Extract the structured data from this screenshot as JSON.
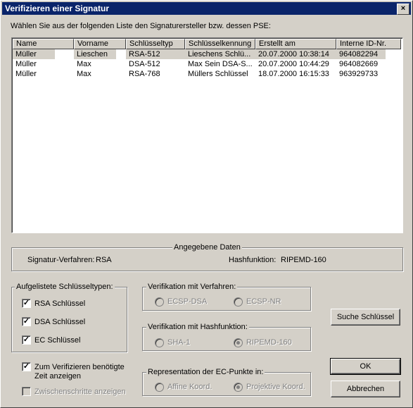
{
  "window": {
    "title": "Verifizieren einer Signatur",
    "close_glyph": "×"
  },
  "instruction": "Wählen Sie aus der folgenden Liste den Signaturersteller bzw. dessen PSE:",
  "table": {
    "columns": [
      "Name",
      "Vorname",
      "Schlüsseltyp",
      "Schlüsselkennung",
      "Erstellt am",
      "Interne ID-Nr."
    ],
    "rows": [
      [
        "Müller",
        "Lieschen",
        "RSA-512",
        "Lieschens Schlü...",
        "20.07.2000 10:38:14",
        "964082294"
      ],
      [
        "Müller",
        "Max",
        "DSA-512",
        "Max Sein DSA-S...",
        "20.07.2000 10:44:29",
        "964082669"
      ],
      [
        "Müller",
        "Max",
        "RSA-768",
        "Müllers Schlüssel",
        "18.07.2000 16:15:33",
        "963929733"
      ]
    ]
  },
  "given_data": {
    "title": "Angegebene Daten",
    "sig_label": "Signatur-Verfahren:",
    "sig_value": "RSA",
    "hash_label": "Hashfunktion:",
    "hash_value": "RIPEMD-160"
  },
  "key_types": {
    "title": "Aufgelistete Schlüsseltypen:",
    "rsa": "RSA Schlüssel",
    "dsa": "DSA Schlüssel",
    "ec": "EC Schlüssel"
  },
  "verification_method": {
    "title": "Verifikation mit Verfahren:",
    "opt1": "ECSP-DSA",
    "opt2": "ECSP-NR"
  },
  "verification_hash": {
    "title": "Verifikation mit Hashfunktion:",
    "opt1": "SHA-1",
    "opt2": "RIPEMD-160"
  },
  "ec_representation": {
    "title": "Representation der EC-Punkte in:",
    "opt1": "Affine Koord.",
    "opt2": "Projektive Koord."
  },
  "options": {
    "show_time_line1": "Zum Verifizieren benötigte",
    "show_time_line2": "Zeit anzeigen",
    "show_steps": "Zwischenschritte anzeigen"
  },
  "buttons": {
    "search": "Suche Schlüssel",
    "ok": "OK",
    "cancel": "Abbrechen"
  },
  "checkmark": "✓"
}
